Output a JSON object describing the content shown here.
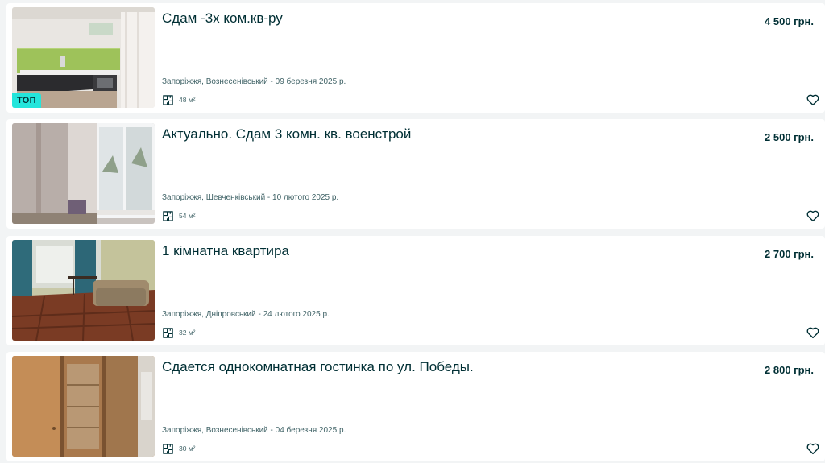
{
  "listings": [
    {
      "title": "Сдам -3х ком.кв-ру",
      "price": "4 500 грн.",
      "location": "Запоріжжя, Вознесенівський - 09 березня 2025 р.",
      "area": "48 м²",
      "badge": "ТОП",
      "photo": "kitchen-photo"
    },
    {
      "title": "Актуально. Сдам 3 комн. кв. военстрой",
      "price": "2 500 грн.",
      "location": "Запоріжжя, Шевченківський - 10 лютого 2025 р.",
      "area": "54 м²",
      "photo": "room-window-photo"
    },
    {
      "title": "1 кімнатна квартира",
      "price": "2 700 грн.",
      "location": "Запоріжжя, Дніпровський - 24 лютого 2025 р.",
      "area": "32 м²",
      "photo": "living-room-photo"
    },
    {
      "title": "Сдается однокомнатная гостинка по ул. Победы.",
      "price": "2 800 грн.",
      "location": "Запоріжжя, Вознесенівський - 04 березня 2025 р.",
      "area": "30 м²",
      "photo": "wardrobe-photo"
    }
  ],
  "icons": {
    "area": "floor-plan-icon",
    "favorite": "heart-outline-icon"
  },
  "colors": {
    "text": "#002f34",
    "muted": "#406367",
    "badge": "#23e5db",
    "background": "#f2f4f5"
  }
}
